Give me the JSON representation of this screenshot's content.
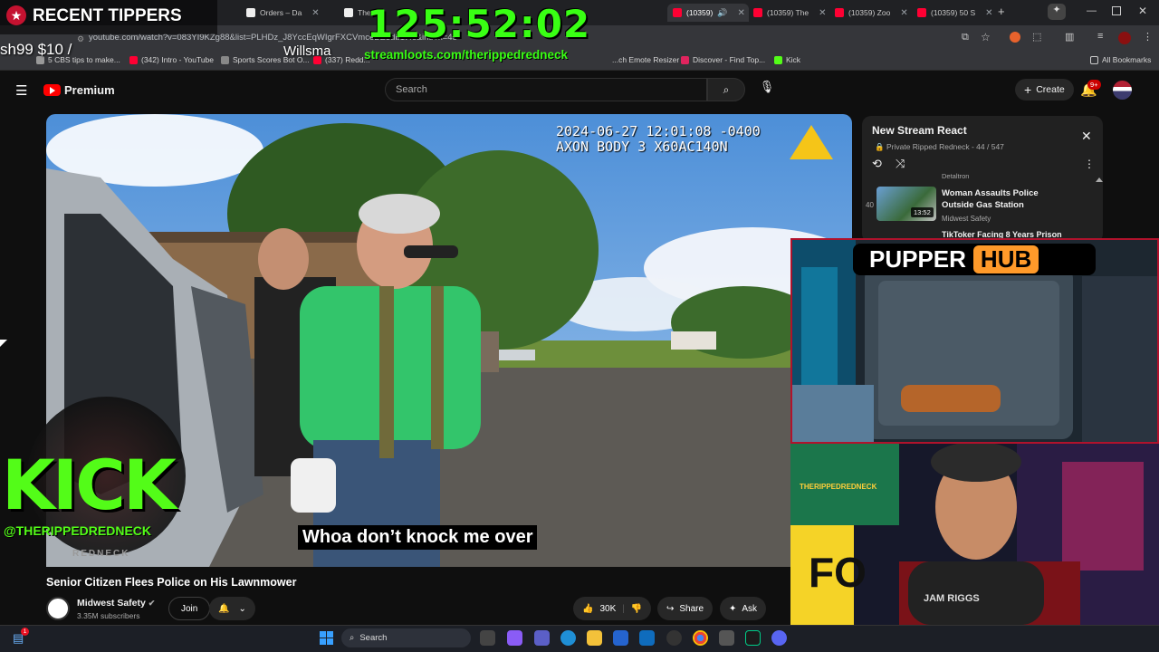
{
  "browser": {
    "tabs": [
      {
        "label": "Orders – Da",
        "color": "#eeeeee"
      },
      {
        "label": "The",
        "color": "#eeeeee"
      },
      {
        "label": "(10359)",
        "color": "#ff0033",
        "active": true
      },
      {
        "label": "(10359) The",
        "color": "#ff0033"
      },
      {
        "label": "(10359) Zoo",
        "color": "#ff0033"
      },
      {
        "label": "(10359) 50 S",
        "color": "#ff0033"
      }
    ],
    "url": "youtube.com/watch?v=083YI9KZg88&list=PLHDz_J8YccEqWIgrFXCVmceBE3db1t4c&index=45",
    "bookmarks": {
      "b1": "5 CBS tips to make...",
      "b2": "(342) Intro - YouTube",
      "b3": "Sports Scores Bot O...",
      "b4": "(337) Redd...",
      "b5": "...ch Emote Resizer",
      "b6": "Discover - Find Top...",
      "b7": "Kick",
      "all": "All Bookmarks"
    }
  },
  "youtube": {
    "logo": "Premium",
    "search_placeholder": "Search",
    "create_label": "Create",
    "notif_badge": "9+",
    "video": {
      "timestamp_line1": "2024-06-27 12:01:08 -0400",
      "timestamp_line2": "AXON BODY 3 X60AC140N",
      "subtitle": "Whoa don’t knock me over",
      "title": "Senior Citizen Flees Police on His Lawnmower",
      "channel": "Midwest Safety",
      "subscribers": "3.35M subscribers",
      "join": "Join",
      "likes": "30K",
      "share": "Share",
      "ask": "Ask"
    },
    "playlist": {
      "title": "New Stream React",
      "meta": "Private Ripped Redneck - 44 / 547",
      "prev_channel": "Detaltron",
      "item_index": "40",
      "item_title": "Woman Assaults Police Outside Gas Station",
      "item_duration": "13:52",
      "item_channel": "Midwest Safety",
      "next_title": "TikToker Facing 8 Years Prison"
    }
  },
  "overlays": {
    "tippers_title": "RECENT TIPPERS",
    "tipper_text": "sh99 $10 /",
    "tipper_name": "Willsma",
    "timer": "125:52:02",
    "streamloots": "streamloots.com/therippedredneck",
    "kick_logo": "KICK",
    "kick_handle": "@THERIPPEDREDNECK",
    "kick_small": "REDNECK",
    "pupper_left": "PUPPER",
    "pupper_right": "HUB",
    "cam_text": "THERIPPEDREDNECK",
    "cam_sign": "FO",
    "cam_shirt": "JAM RIGGS"
  },
  "taskbar": {
    "search": "Search",
    "badge": "1"
  }
}
